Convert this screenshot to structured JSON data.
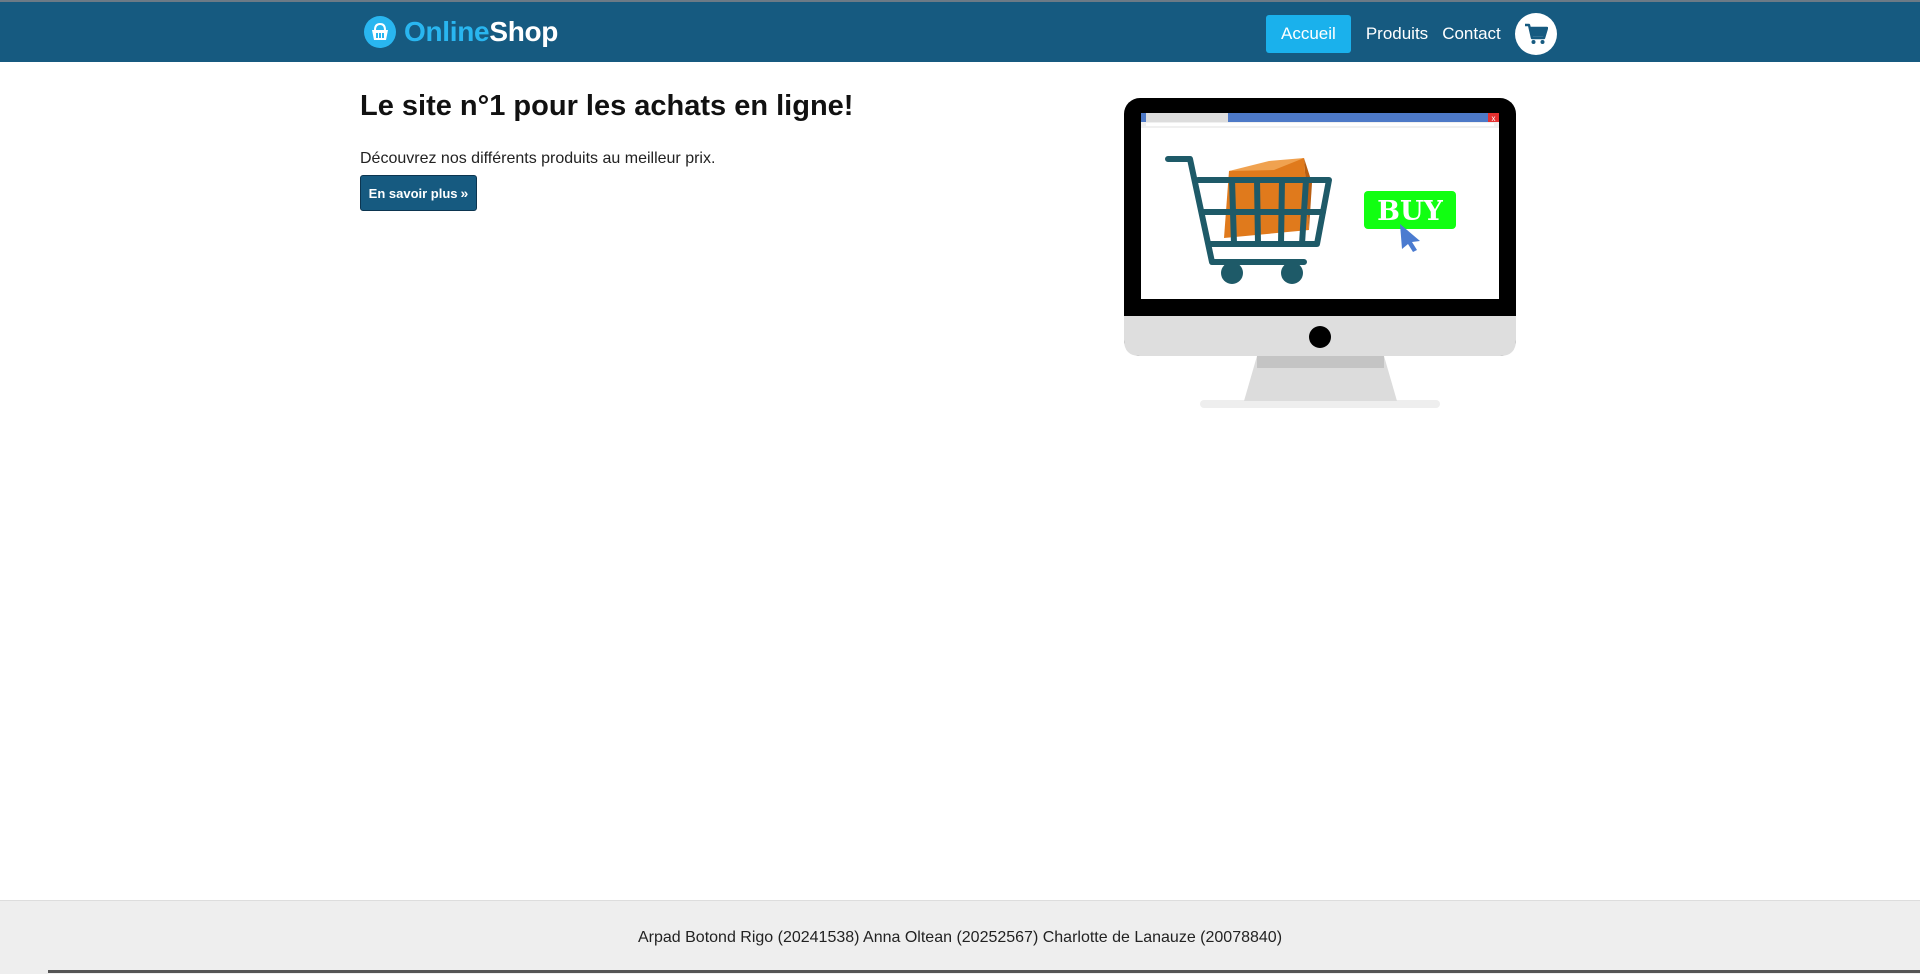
{
  "brand": {
    "name_part1": "Online",
    "name_part2": "Shop",
    "icon": "shopping-basket-icon"
  },
  "nav": {
    "items": [
      {
        "label": "Accueil",
        "active": true
      },
      {
        "label": "Produits",
        "active": false
      },
      {
        "label": "Contact",
        "active": false
      }
    ],
    "cart_icon": "shopping-cart-icon"
  },
  "hero": {
    "title": "Le site n°1 pour les achats en ligne!",
    "text": "Découvrez nos différents produits au meilleur prix.",
    "button_label": "En savoir plus",
    "button_icon": "double-chevron-right-icon",
    "illustration": {
      "buy_label": "BUY",
      "close_label": "x"
    }
  },
  "footer": {
    "text": "Arpad Botond Rigo (20241538) Anna Oltean (20252567) Charlotte de Lanauze (20078840)"
  },
  "colors": {
    "navbar": "#165a80",
    "active_nav": "#1ab1ec",
    "brand_accent": "#29b6f0",
    "footer_bg": "#eeeeee",
    "buy_green": "#11ff11",
    "box_orange": "#e07a1c",
    "cart_teal": "#1e5a68"
  }
}
